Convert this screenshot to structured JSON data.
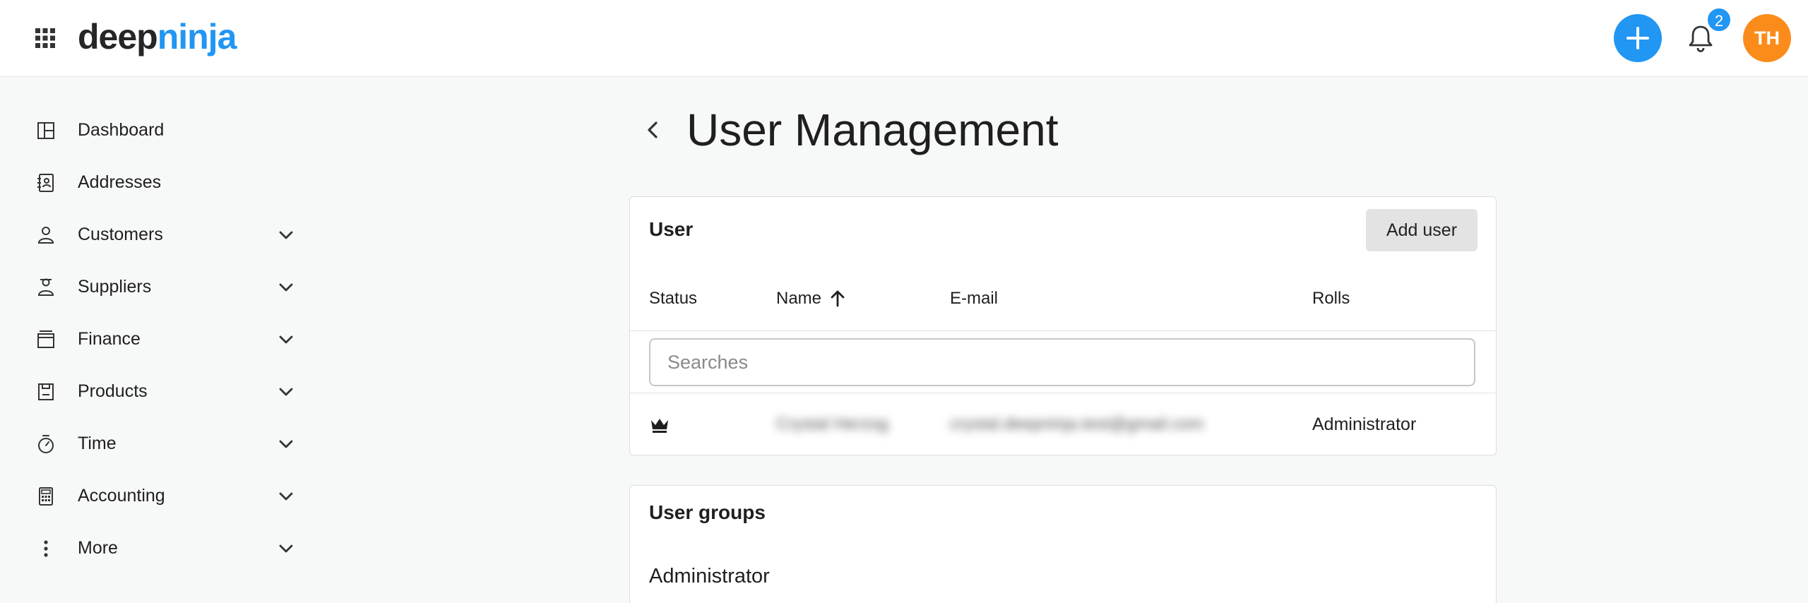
{
  "header": {
    "logo_part1": "deep",
    "logo_part2": "ninja",
    "notification_count": "2",
    "avatar_initials": "TH",
    "colors": {
      "accent": "#2196f3",
      "avatar": "#fb8c1b"
    }
  },
  "sidebar": {
    "items": [
      {
        "label": "Dashboard",
        "icon": "dashboard-icon",
        "expandable": false
      },
      {
        "label": "Addresses",
        "icon": "address-book-icon",
        "expandable": false
      },
      {
        "label": "Customers",
        "icon": "customers-icon",
        "expandable": true
      },
      {
        "label": "Suppliers",
        "icon": "suppliers-icon",
        "expandable": true
      },
      {
        "label": "Finance",
        "icon": "finance-icon",
        "expandable": true
      },
      {
        "label": "Products",
        "icon": "products-icon",
        "expandable": true
      },
      {
        "label": "Time",
        "icon": "stopwatch-icon",
        "expandable": true
      },
      {
        "label": "Accounting",
        "icon": "calculator-icon",
        "expandable": true
      },
      {
        "label": "More",
        "icon": "more-vertical-icon",
        "expandable": true
      }
    ]
  },
  "page": {
    "title": "User Management"
  },
  "users_card": {
    "title": "User",
    "add_button_label": "Add user",
    "columns": {
      "status": "Status",
      "name": "Name",
      "email": "E-mail",
      "roles": "Rolls"
    },
    "search_placeholder": "Searches",
    "rows": [
      {
        "status_icon": "crown-icon",
        "name": "Crystal Herzog",
        "email": "crystal.deepninja.test@gmail.com",
        "role": "Administrator"
      }
    ]
  },
  "groups_card": {
    "title": "User groups",
    "items": [
      "Administrator"
    ]
  }
}
